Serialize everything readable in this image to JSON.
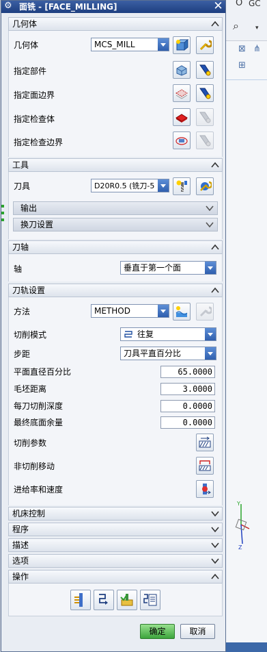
{
  "dialog": {
    "title": "面铣 - [FACE_MILLING]"
  },
  "geometry": {
    "header": "几何体",
    "geom_label": "几何体",
    "geom_value": "MCS_MILL",
    "specify_part": "指定部件",
    "specify_face_boundary": "指定面边界",
    "specify_check_body": "指定检查体",
    "specify_check_boundary": "指定检查边界"
  },
  "tool": {
    "header": "工具",
    "tool_label": "刀具",
    "tool_value": "D20R0.5 (铣刀-5",
    "output_label": "输出",
    "tool_change_label": "换刀设置"
  },
  "tool_axis": {
    "header": "刀轴",
    "axis_label": "轴",
    "axis_value": "垂直于第一个面"
  },
  "path_settings": {
    "header": "刀轨设置",
    "method_label": "方法",
    "method_value": "METHOD",
    "cut_pattern_label": "切削模式",
    "cut_pattern_value": "往复",
    "stepover_label": "步距",
    "stepover_value": "刀具平直百分比",
    "flat_diameter_label": "平面直径百分比",
    "flat_diameter_value": "65.0000",
    "blank_distance_label": "毛坯距离",
    "blank_distance_value": "3.0000",
    "depth_per_cut_label": "每刀切削深度",
    "depth_per_cut_value": "0.0000",
    "final_floor_stock_label": "最终底面余量",
    "final_floor_stock_value": "0.0000",
    "cutting_params_label": "切削参数",
    "non_cutting_moves_label": "非切削移动",
    "feeds_speeds_label": "进给率和速度"
  },
  "collapsed_sections": {
    "machine_control": "机床控制",
    "program": "程序",
    "description": "描述",
    "options": "选项"
  },
  "actions": {
    "header": "操作"
  },
  "buttons": {
    "ok": "确定",
    "cancel": "取消"
  },
  "background": {
    "top_right_text": "GC",
    "top_right_glyph": "O"
  },
  "colors": {
    "title_bar": "#1e3f80",
    "accent_blue": "#2f5fae",
    "ok_green": "#3ca43c"
  }
}
